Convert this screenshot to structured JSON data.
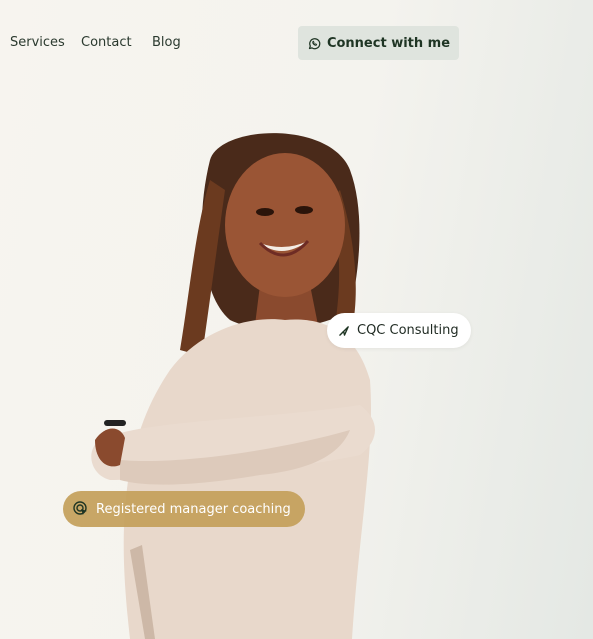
{
  "nav": {
    "links": [
      "Services",
      "Contact",
      "Blog"
    ],
    "cta_label": "Connect with me",
    "cta_icon": "whatsapp-icon"
  },
  "hero": {
    "portrait_alt": "Smiling woman with braided hair, arms crossed, wearing a cream blouse",
    "tags": [
      {
        "label": "CQC Consulting",
        "icon": "send-arrow-icon"
      },
      {
        "label": "Registered manager coaching",
        "icon": "target-cursor-icon"
      }
    ]
  },
  "colors": {
    "accent_gold": "#c3a05a",
    "text_dark_green": "#1f3524",
    "button_bg": "#dfe4de"
  }
}
